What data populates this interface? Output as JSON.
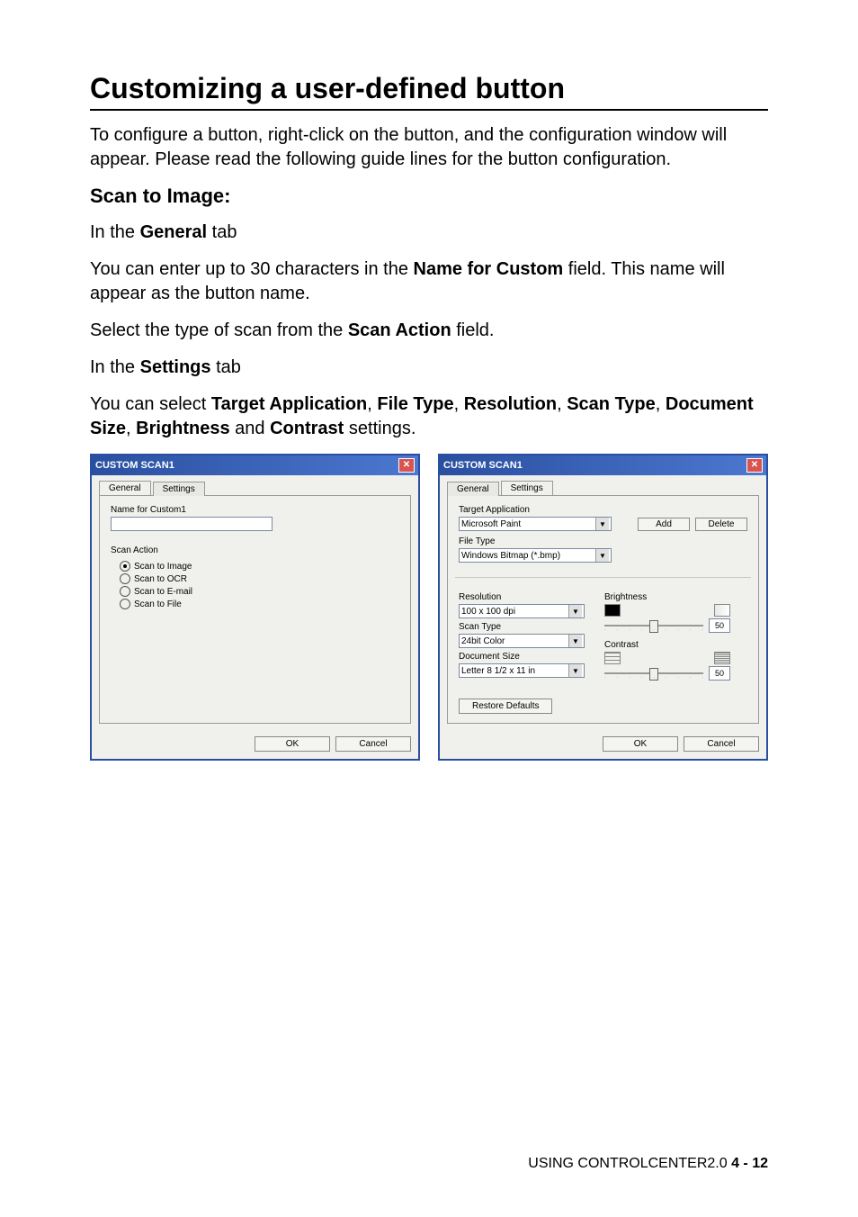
{
  "doc": {
    "title": "Customizing a user-defined button",
    "para1": "To configure a button, right-click on the button, and the configuration window will appear. Please read the following guide lines for the button configuration.",
    "scan_to_image_heading": "Scan to Image:",
    "in_the": "In the ",
    "general_word": "General",
    "settings_word": "Settings",
    "tab_word": " tab",
    "para2a": "You can enter up to 30 characters in the ",
    "name_for_custom": "Name for Custom",
    "para2b": " field. This name will appear as the button name.",
    "para3a": "Select the type of scan from the ",
    "scan_action_bold": "Scan Action",
    "para3b": " field.",
    "para4a": "You can select ",
    "target_app": "Target Application",
    "sep": ", ",
    "file_type": "File Type",
    "resolution": "Resolution",
    "scan_type": "Scan Type",
    "document_size": "Document Size",
    "brightness": "Brightness",
    "and": " and ",
    "contrast": "Contrast",
    "para4b": " settings."
  },
  "dlg1": {
    "title": "CUSTOM SCAN1",
    "tab_general": "General",
    "tab_settings": "Settings",
    "name_label": "Name for Custom1",
    "name_value": "",
    "scan_action_label": "Scan Action",
    "r1": "Scan to Image",
    "r2": "Scan to OCR",
    "r3": "Scan to E-mail",
    "r4": "Scan to File",
    "ok": "OK",
    "cancel": "Cancel"
  },
  "dlg2": {
    "title": "CUSTOM SCAN1",
    "tab_general": "General",
    "tab_settings": "Settings",
    "target_app_label": "Target Application",
    "target_app_value": "Microsoft Paint",
    "add": "Add",
    "delete": "Delete",
    "file_type_label": "File Type",
    "file_type_value": "Windows Bitmap (*.bmp)",
    "resolution_label": "Resolution",
    "resolution_value": "100 x 100 dpi",
    "scan_type_label": "Scan Type",
    "scan_type_value": "24bit Color",
    "document_size_label": "Document Size",
    "document_size_value": "Letter 8 1/2 x 11 in",
    "brightness_label": "Brightness",
    "brightness_value": "50",
    "contrast_label": "Contrast",
    "contrast_value": "50",
    "restore": "Restore Defaults",
    "ok": "OK",
    "cancel": "Cancel"
  },
  "footer": {
    "text": "USING CONTROLCENTER2.0   ",
    "page": "4 - 12"
  }
}
